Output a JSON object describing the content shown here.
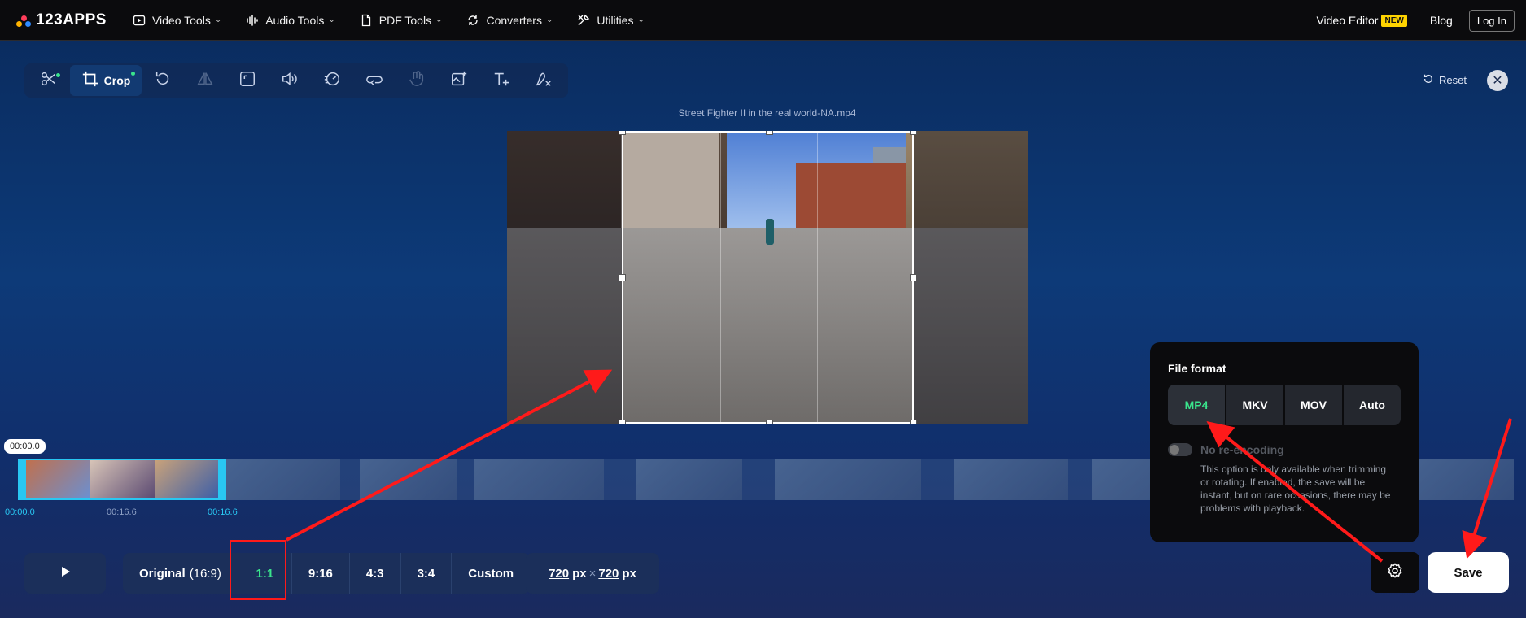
{
  "nav": {
    "logo": "123APPS",
    "items": [
      {
        "label": "Video Tools",
        "icon": "video-icon"
      },
      {
        "label": "Audio Tools",
        "icon": "audio-icon"
      },
      {
        "label": "PDF Tools",
        "icon": "pdf-icon"
      },
      {
        "label": "Converters",
        "icon": "converters-icon"
      },
      {
        "label": "Utilities",
        "icon": "utilities-icon"
      }
    ],
    "video_editor": "Video Editor",
    "new_badge": "NEW",
    "blog": "Blog",
    "login": "Log In"
  },
  "toolbar": {
    "crop_label": "Crop",
    "tools": [
      "trim",
      "crop",
      "rotate",
      "flip",
      "resize",
      "volume",
      "speed",
      "loop",
      "stabilize",
      "add-image",
      "add-text",
      "remove-logo"
    ]
  },
  "reset_label": "Reset",
  "file_title": "Street Fighter II in the real world-NA.mp4",
  "timeline": {
    "bubble_time": "00:00.0",
    "start": "00:00.0",
    "mid": "00:16.6",
    "end": "00:16.6"
  },
  "ratios": {
    "original": "Original",
    "original_sub": "(16:9)",
    "items": [
      "1:1",
      "9:16",
      "4:3",
      "3:4",
      "Custom"
    ],
    "active": "1:1"
  },
  "size": {
    "width": "720",
    "height": "720",
    "unit": "px",
    "times": "×"
  },
  "format_popup": {
    "title": "File format",
    "formats": [
      "MP4",
      "MKV",
      "MOV",
      "Auto"
    ],
    "active": "MP4",
    "reencoding_label": "No re-encoding",
    "reencoding_desc": "This option is only available when trimming or rotating. If enabled, the save will be instant, but on rare occasions, there may be problems with playback."
  },
  "save_label": "Save",
  "colors": {
    "accent_green": "#3ae58c",
    "timeline_blue": "#29c7f2",
    "annotation_red": "#ff1a1a"
  }
}
